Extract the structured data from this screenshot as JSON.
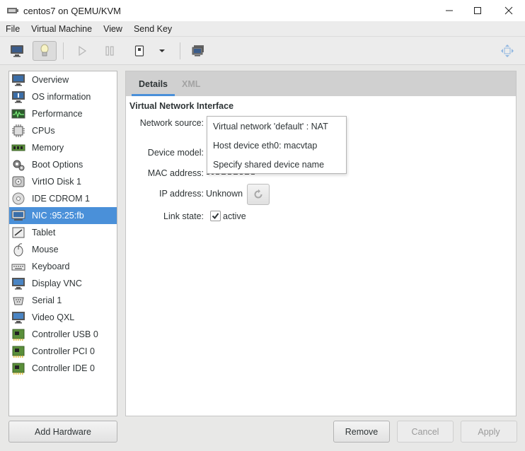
{
  "window": {
    "title": "centos7 on QEMU/KVM",
    "minimize": "—",
    "maximize": "☐",
    "close": "✕"
  },
  "menu": [
    "File",
    "Virtual Machine",
    "View",
    "Send Key"
  ],
  "sidebar": {
    "items": [
      {
        "label": "Overview",
        "icon": "monitor-icon"
      },
      {
        "label": "OS information",
        "icon": "monitor-info-icon"
      },
      {
        "label": "Performance",
        "icon": "performance-graph-icon"
      },
      {
        "label": "CPUs",
        "icon": "cpu-chip-icon"
      },
      {
        "label": "Memory",
        "icon": "memory-stick-icon"
      },
      {
        "label": "Boot Options",
        "icon": "gears-icon"
      },
      {
        "label": "VirtIO Disk 1",
        "icon": "hard-disk-icon"
      },
      {
        "label": "IDE CDROM 1",
        "icon": "cdrom-icon"
      },
      {
        "label": "NIC :95:25:fb",
        "icon": "network-card-icon"
      },
      {
        "label": "Tablet",
        "icon": "tablet-icon"
      },
      {
        "label": "Mouse",
        "icon": "mouse-icon"
      },
      {
        "label": "Keyboard",
        "icon": "keyboard-icon"
      },
      {
        "label": "Display VNC",
        "icon": "display-icon"
      },
      {
        "label": "Serial 1",
        "icon": "serial-icon"
      },
      {
        "label": "Video QXL",
        "icon": "video-icon"
      },
      {
        "label": "Controller USB 0",
        "icon": "controller-icon"
      },
      {
        "label": "Controller PCI 0",
        "icon": "controller-icon"
      },
      {
        "label": "Controller IDE 0",
        "icon": "controller-icon"
      }
    ],
    "selected_index": 8
  },
  "tabs": {
    "details": "Details",
    "xml": "XML"
  },
  "section_title": "Virtual Network Interface",
  "fields": {
    "network_source_label": "Network source:",
    "device_model_label": "Device model:",
    "mac_address_label": "MAC address:",
    "ip_address_label": "IP address:",
    "ip_address_value": "Unknown",
    "link_state_label": "Link state:",
    "link_state_value": "active",
    "link_state_checked": true
  },
  "network_source_options": [
    "Virtual network 'default' : NAT",
    "Host device eth0: macvtap",
    "Specify shared device name"
  ],
  "buttons": {
    "add_hardware": "Add Hardware",
    "remove": "Remove",
    "cancel": "Cancel",
    "apply": "Apply"
  },
  "colors": {
    "selection": "#4a90d9"
  }
}
